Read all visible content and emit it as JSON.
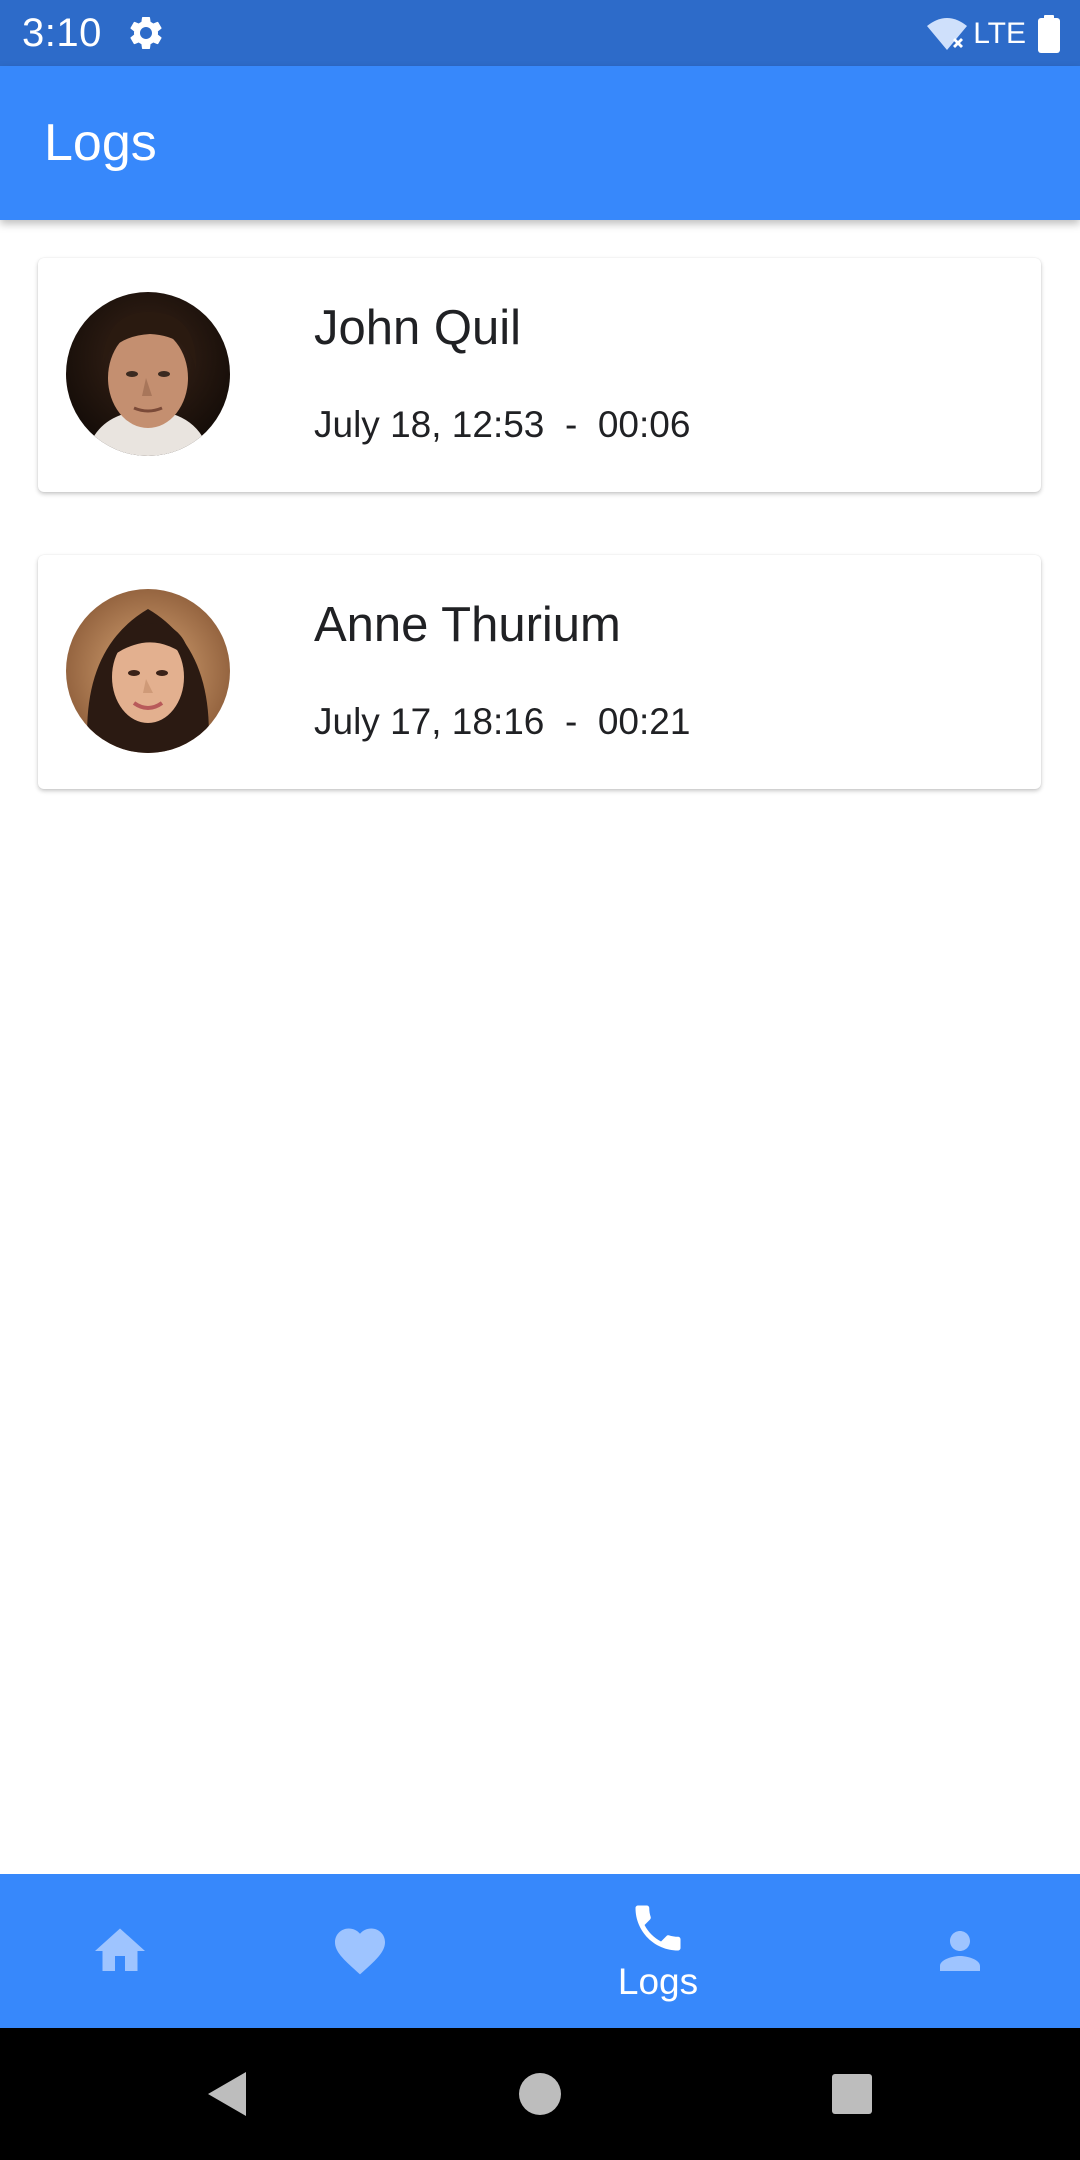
{
  "status_bar": {
    "time": "3:10",
    "network": "LTE",
    "settings_icon": "gear-icon",
    "wifi_icon": "wifi-off-icon",
    "battery_icon": "battery-full-icon"
  },
  "app_bar": {
    "title": "Logs"
  },
  "logs": [
    {
      "name": "John Quil",
      "details": "July 18, 12:53  -  00:06",
      "avatar_icon": "contact-photo"
    },
    {
      "name": "Anne Thurium",
      "details": "July 17, 18:16  -  00:21",
      "avatar_icon": "contact-photo"
    }
  ],
  "bottom_nav": {
    "items": [
      {
        "icon": "home-icon",
        "label": "",
        "active": false
      },
      {
        "icon": "heart-icon",
        "label": "",
        "active": false
      },
      {
        "icon": "phone-icon",
        "label": "Logs",
        "active": true
      },
      {
        "icon": "person-icon",
        "label": "",
        "active": false
      }
    ]
  },
  "system_nav": {
    "back_icon": "back-triangle-icon",
    "home_icon": "home-circle-icon",
    "recents_icon": "recents-square-icon"
  },
  "colors": {
    "status_bar": "#2d6bc9",
    "primary": "#3788fb",
    "nav_inactive": "#9ec4ff",
    "nav_active": "#ffffff"
  }
}
